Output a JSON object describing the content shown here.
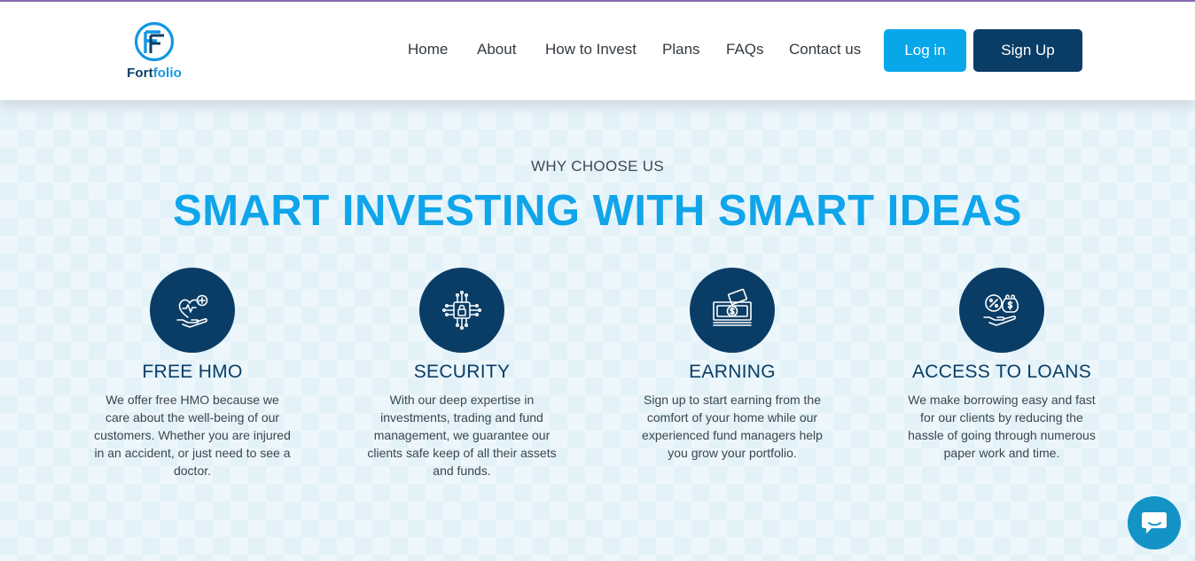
{
  "brand": {
    "name_part1": "Fort",
    "name_part2": "folio",
    "colors": {
      "navy": "#0a3d66",
      "blue": "#07a7ea",
      "headline_blue": "#10a5ea"
    }
  },
  "nav": {
    "links": [
      "Home",
      "About",
      "How to Invest",
      "Plans",
      "FAQs",
      "Contact us"
    ],
    "login_label": "Log in",
    "signup_label": "Sign Up"
  },
  "section": {
    "eyebrow": "WHY CHOOSE US",
    "headline": "SMART INVESTING WITH SMART IDEAS",
    "features": [
      {
        "icon": "health-hand-icon",
        "title": "FREE HMO",
        "description": "We offer free HMO because we care about the well-being of our customers. Whether you are injured in an accident, or just need to see a doctor."
      },
      {
        "icon": "security-chip-icon",
        "title": "SECURITY",
        "description": "With our deep expertise in investments, trading and fund management, we guarantee our clients safe keep of all their assets and funds."
      },
      {
        "icon": "cash-money-icon",
        "title": "EARNING",
        "description": "Sign up to start earning from the comfort of your home while our experienced fund managers help you grow your portfolio."
      },
      {
        "icon": "loan-hand-icon",
        "title": "ACCESS TO LOANS",
        "description": "We make borrowing easy and fast for our clients by reducing the hassle of going through numerous paper work and time."
      }
    ]
  },
  "chat": {
    "icon": "chat-bubble-icon"
  }
}
